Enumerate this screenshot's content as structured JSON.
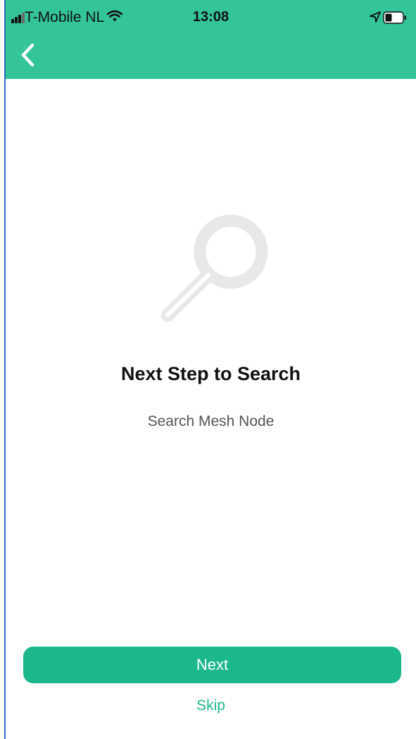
{
  "status_bar": {
    "carrier": "T-Mobile NL",
    "time": "13:08",
    "icons": [
      "signal-icon",
      "wifi-icon",
      "location-icon",
      "battery-icon"
    ]
  },
  "header": {
    "back_icon": "chevron-left-icon"
  },
  "main": {
    "illustration_icon": "magnifier-icon",
    "title": "Next Step to Search",
    "subtitle": "Search Mesh Node"
  },
  "actions": {
    "next_label": "Next",
    "skip_label": "Skip"
  },
  "colors": {
    "header": "#34c49a",
    "primary_button": "#1db78e",
    "link": "#1db78e",
    "illustration": "#e8e8e8"
  }
}
